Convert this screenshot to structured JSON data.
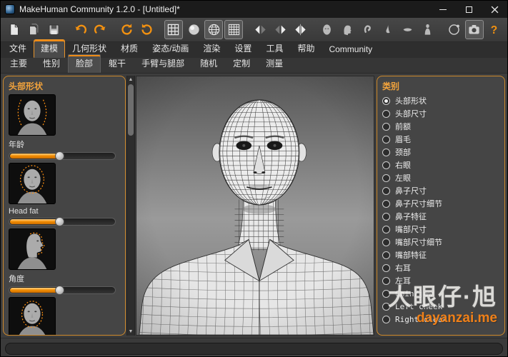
{
  "window": {
    "title": "MakeHuman Community 1.2.0 - [Untitled]*"
  },
  "toolbar": {
    "buttons": [
      {
        "key": "new",
        "icon": "page-icon"
      },
      {
        "key": "load",
        "icon": "pages-icon"
      },
      {
        "key": "save",
        "icon": "save-icon"
      },
      {
        "key": "undo",
        "icon": "undo-icon",
        "gap": true
      },
      {
        "key": "redo",
        "icon": "redo-icon"
      },
      {
        "key": "reset-camera",
        "icon": "refresh-cw-icon",
        "gap": true
      },
      {
        "key": "reload",
        "icon": "refresh-ccw-icon"
      },
      {
        "key": "grid",
        "icon": "grid-icon",
        "pressed": true,
        "gap": true
      },
      {
        "key": "smooth-shading",
        "icon": "smooth-sphere-icon"
      },
      {
        "key": "wireframe",
        "icon": "wire-sphere-icon",
        "pressed": true
      },
      {
        "key": "subdivision",
        "icon": "dense-grid-icon",
        "pressed": true
      },
      {
        "key": "symmetry-left",
        "icon": "symmetry-left-icon",
        "gap": true
      },
      {
        "key": "symmetry-right",
        "icon": "symmetry-right-icon"
      },
      {
        "key": "symmetry-both",
        "icon": "symmetry-both-icon"
      },
      {
        "key": "view-face",
        "icon": "head-front-icon",
        "gap": true
      },
      {
        "key": "view-side",
        "icon": "head-side-icon"
      },
      {
        "key": "view-ear",
        "icon": "ear-icon"
      },
      {
        "key": "view-nose",
        "icon": "nose-icon"
      },
      {
        "key": "view-mouth",
        "icon": "mouth-icon"
      },
      {
        "key": "view-body",
        "icon": "body-icon"
      },
      {
        "key": "orbit",
        "icon": "orbit-icon",
        "gap": true
      },
      {
        "key": "screenshot",
        "icon": "camera-icon",
        "pressed": true,
        "push_right": true
      },
      {
        "key": "help",
        "icon": "help-icon"
      }
    ]
  },
  "menubar": {
    "items": [
      {
        "key": "files",
        "label": "文件"
      },
      {
        "key": "modelling",
        "label": "建模",
        "active": true
      },
      {
        "key": "geometries",
        "label": "几何形状"
      },
      {
        "key": "materials",
        "label": "材质"
      },
      {
        "key": "pose-animate",
        "label": "姿态/动画"
      },
      {
        "key": "rendering",
        "label": "渲染"
      },
      {
        "key": "settings",
        "label": "设置"
      },
      {
        "key": "utilities",
        "label": "工具"
      },
      {
        "key": "help",
        "label": "帮助"
      },
      {
        "key": "community",
        "label": "Community"
      }
    ]
  },
  "tabbar": {
    "items": [
      {
        "key": "main",
        "label": "主要"
      },
      {
        "key": "gender",
        "label": "性别"
      },
      {
        "key": "face",
        "label": "脸部",
        "active": true
      },
      {
        "key": "torso",
        "label": "躯干"
      },
      {
        "key": "arms-legs",
        "label": "手臂与腿部"
      },
      {
        "key": "random",
        "label": "随机"
      },
      {
        "key": "custom",
        "label": "定制"
      },
      {
        "key": "measure",
        "label": "测量"
      }
    ]
  },
  "left_panel": {
    "title": "头部形状",
    "items": [
      {
        "key": "age",
        "label": "年龄",
        "value": 47,
        "thumb": "front-sides"
      },
      {
        "key": "head-fat",
        "label": "Head fat",
        "value": 47,
        "thumb": "front-oval"
      },
      {
        "key": "angle",
        "label": "角度",
        "value": 47,
        "thumb": "profile"
      },
      {
        "key": "oval",
        "label": "",
        "value": 47,
        "thumb": "front-oval2"
      }
    ]
  },
  "right_panel": {
    "title": "类别",
    "options": [
      {
        "key": "head-shape",
        "label": "头部形状",
        "selected": true
      },
      {
        "key": "head-size",
        "label": "头部尺寸"
      },
      {
        "key": "forehead",
        "label": "前额"
      },
      {
        "key": "eyebrows",
        "label": "眉毛"
      },
      {
        "key": "neck",
        "label": "颈部"
      },
      {
        "key": "right-eye",
        "label": "右眼"
      },
      {
        "key": "left-eye",
        "label": "左眼"
      },
      {
        "key": "nose-size",
        "label": "鼻子尺寸"
      },
      {
        "key": "nose-size-details",
        "label": "鼻子尺寸细节"
      },
      {
        "key": "nose-features",
        "label": "鼻子特征"
      },
      {
        "key": "mouth-size",
        "label": "嘴部尺寸"
      },
      {
        "key": "mouth-size-details",
        "label": "嘴部尺寸细节"
      },
      {
        "key": "mouth-features",
        "label": "嘴部特征"
      },
      {
        "key": "right-ear",
        "label": "右耳"
      },
      {
        "key": "left-ear",
        "label": "左耳"
      },
      {
        "key": "chin-jaw",
        "label": "Chin/jaw"
      },
      {
        "key": "left-cheek",
        "label": "Left cheek"
      },
      {
        "key": "right-cheek",
        "label": "Right cheek"
      }
    ]
  },
  "command_line": {
    "value": ""
  },
  "watermark": {
    "line1": "大眼仔·旭",
    "line2": "dayanzai.me"
  },
  "colors": {
    "accent_orange": "#ef8b16",
    "groupbox_border": "#cf8a2b",
    "titlebar_bg": "#1b1b1b"
  }
}
